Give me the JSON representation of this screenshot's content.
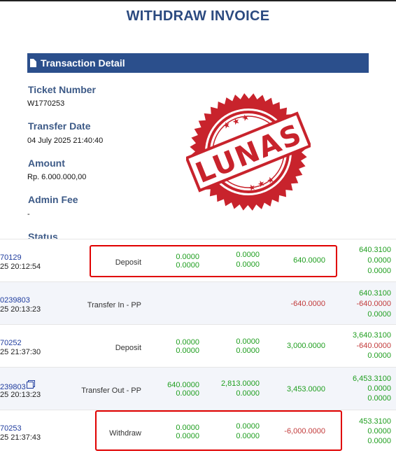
{
  "invoice": {
    "title": "WITHDRAW INVOICE",
    "section_title": "Transaction Detail",
    "fields": [
      {
        "label": "Ticket Number",
        "value": "W1770253"
      },
      {
        "label": "Transfer Date",
        "value": "04 July 2025 21:40:40"
      },
      {
        "label": "Amount",
        "value": "Rp. 6.000.000,00"
      },
      {
        "label": "Admin Fee",
        "value": "-"
      },
      {
        "label": "Status",
        "value": ""
      }
    ],
    "stamp_text": "LUNAS",
    "stamp_color": "#c8232c"
  },
  "transactions": [
    {
      "id": "70129",
      "time": "25 20:12:54",
      "type": "Deposit",
      "c1": [
        "0.0000",
        "0.0000"
      ],
      "c2": [
        "0.0000",
        "0.0000"
      ],
      "amount": "640.0000",
      "balance": [
        "640.3100",
        "0.0000",
        "0.0000"
      ],
      "highlighted": true
    },
    {
      "id": "0239803",
      "time": "25 20:13:23",
      "type": "Transfer In - PP",
      "c1": [
        "",
        ""
      ],
      "c2": [
        "",
        ""
      ],
      "amount": "-640.0000",
      "balance": [
        "640.3100",
        "-640.0000",
        "0.0000"
      ],
      "highlighted": false
    },
    {
      "id": "70252",
      "time": "25 21:37:30",
      "type": "Deposit",
      "c1": [
        "0.0000",
        "0.0000"
      ],
      "c2": [
        "0.0000",
        "0.0000"
      ],
      "amount": "3,000.0000",
      "balance": [
        "3,640.3100",
        "-640.0000",
        "0.0000"
      ],
      "highlighted": false
    },
    {
      "id": "239803",
      "time": "25 20:13:23",
      "type": "Transfer Out - PP",
      "c1": [
        "640.0000",
        "0.0000"
      ],
      "c2": [
        "2,813.0000",
        "0.0000"
      ],
      "amount": "3,453.0000",
      "balance": [
        "6,453.3100",
        "0.0000",
        "0.0000"
      ],
      "highlighted": false
    },
    {
      "id": "70253",
      "time": "25 21:37:43",
      "type": "Withdraw",
      "c1": [
        "0.0000",
        "0.0000"
      ],
      "c2": [
        "0.0000",
        "0.0000"
      ],
      "amount": "-6,000.0000",
      "balance": [
        "453.3100",
        "0.0000",
        "0.0000"
      ],
      "highlighted": true
    }
  ]
}
